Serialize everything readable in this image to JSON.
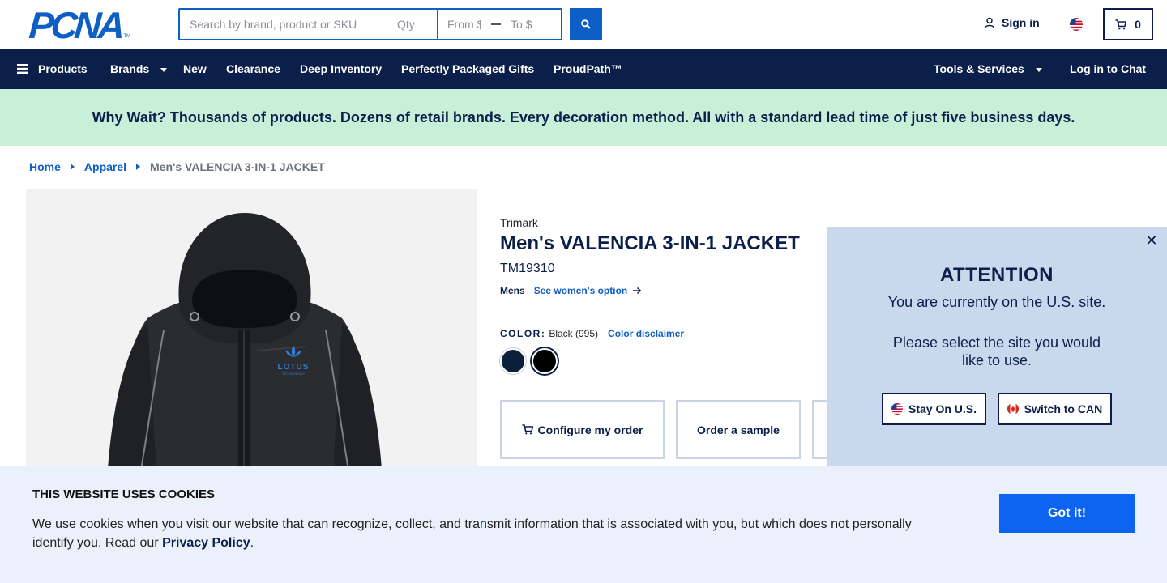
{
  "header": {
    "logo_text": "PCNA",
    "logo_tm": "TM",
    "search_placeholder": "Search by brand, product or SKU",
    "qty_placeholder": "Qty",
    "from_placeholder": "From $",
    "to_placeholder": "To $",
    "sign_in": "Sign in",
    "cart_count": "0"
  },
  "nav": {
    "products": "Products",
    "brands": "Brands",
    "new": "New",
    "clearance": "Clearance",
    "deep_inventory": "Deep Inventory",
    "gifts": "Perfectly Packaged Gifts",
    "proudpath": "ProudPath™",
    "tools": "Tools & Services",
    "chat": "Log in to Chat"
  },
  "promo": "Why Wait? Thousands of products. Dozens of retail brands. Every decoration method. All with a standard lead time of just five business days.",
  "breadcrumb": {
    "home": "Home",
    "apparel": "Apparel",
    "current": "Men's VALENCIA 3-IN-1 JACKET"
  },
  "product": {
    "brand": "Trimark",
    "title": "Men's VALENCIA 3-IN-1 JACKET",
    "sku": "TM19310",
    "gender": "Mens",
    "alt_option": "See women's option",
    "color_label": "COLOR:",
    "color_value": "Black (995)",
    "color_disclaimer": "Color disclaimer",
    "swatches": [
      "#0b1f3a",
      "#000000"
    ],
    "imprint_name": "LOTUS",
    "imprint_sub": "TECHNOLOGY",
    "configure": "Configure my order",
    "sample": "Order a sample"
  },
  "attention": {
    "title": "ATTENTION",
    "line1": "You are currently on the U.S. site.",
    "line2": "Please select the site you would like to use.",
    "stay": "Stay On U.S.",
    "switch": "Switch to CAN"
  },
  "cookie": {
    "title": "THIS WEBSITE USES COOKIES",
    "text": "We use cookies when you visit our website that can recognize, collect, and transmit information that is associated with you, but which does not personally identify you. Read our ",
    "link": "Privacy Policy",
    "end": ".",
    "button": "Got it!"
  },
  "colors": {
    "navy": "#0b1f4a",
    "blue": "#0d5fc5",
    "promo_bg": "#c8f0d8",
    "modal_bg": "#c9d8ec",
    "cookie_bg": "#ebf1fa"
  }
}
